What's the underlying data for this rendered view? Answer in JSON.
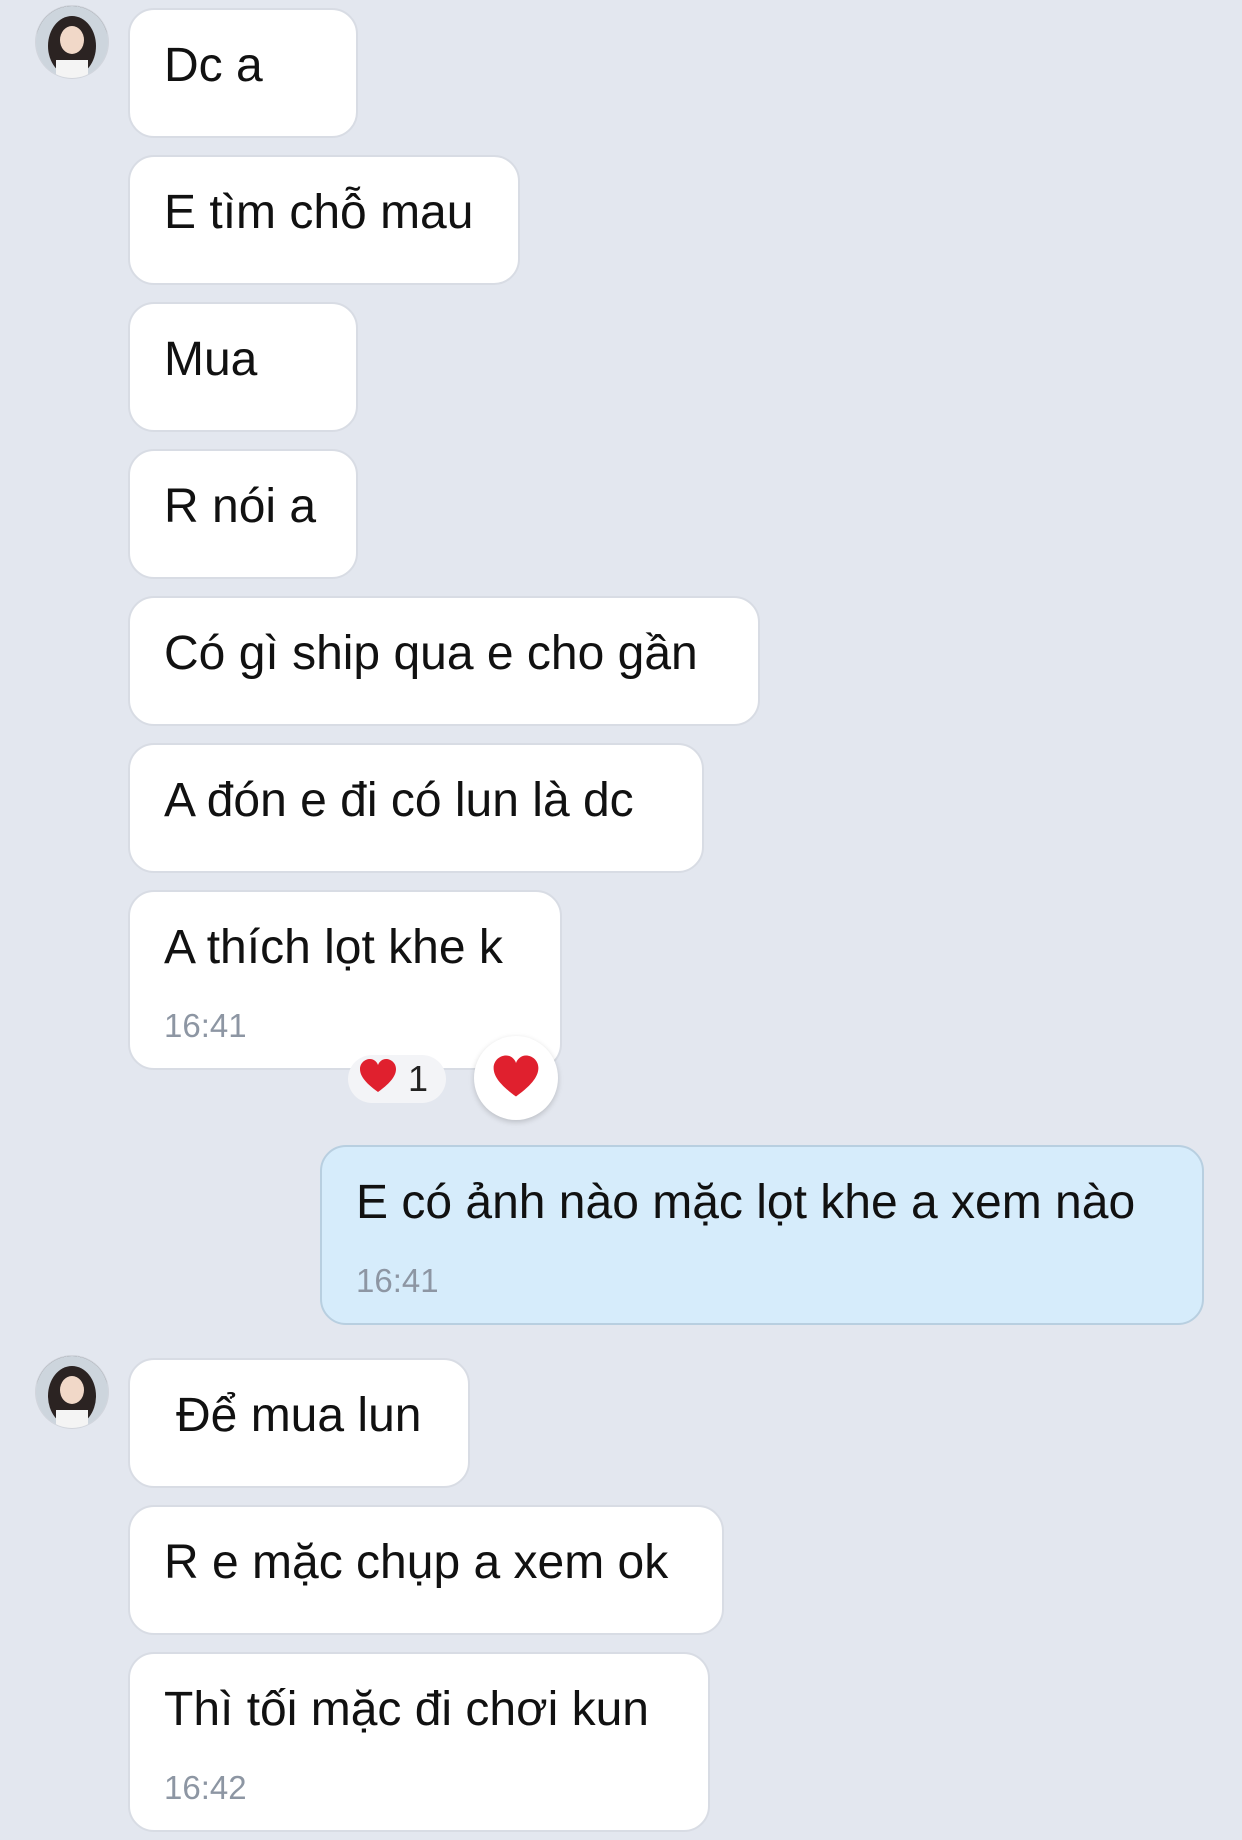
{
  "messages": [
    {
      "text": "Dc a"
    },
    {
      "text": "E tìm chỗ mau"
    },
    {
      "text": "Mua"
    },
    {
      "text": "R nói a"
    },
    {
      "text": "Có gì ship qua e cho gần"
    },
    {
      "text": "A đón e đi có lun là dc"
    },
    {
      "text": "A thích lọt khe k",
      "time": "16:41"
    },
    {
      "text": "E có ảnh nào mặc lọt khe a xem nào",
      "time": "16:41"
    },
    {
      "text": "Để mua lun"
    },
    {
      "text": "R e mặc chụp a xem ok"
    },
    {
      "text": "Thì tối mặc đi chơi kun",
      "time": "16:42"
    }
  ],
  "reaction": {
    "icon": "heart-icon",
    "count": "1",
    "color": "#e0202e"
  },
  "colors": {
    "background": "#e3e7ef",
    "incoming_bubble": "#ffffff",
    "outgoing_bubble": "#d6ecfb"
  }
}
